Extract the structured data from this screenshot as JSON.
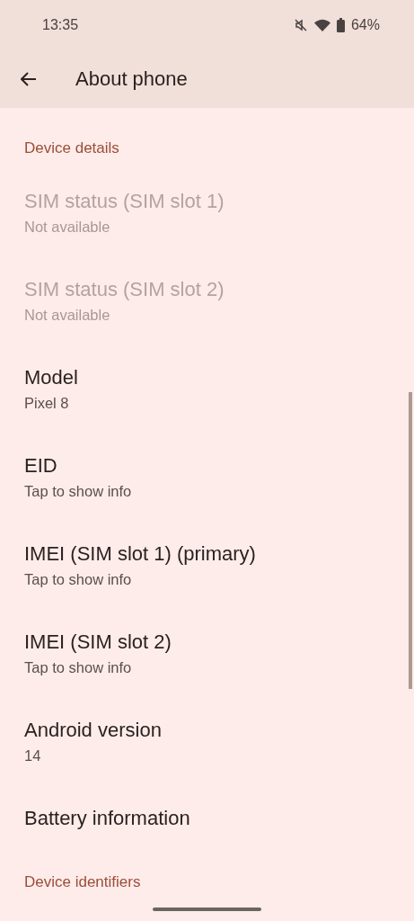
{
  "status_bar": {
    "time": "13:35",
    "battery": "64%"
  },
  "app_bar": {
    "title": "About phone"
  },
  "sections": [
    {
      "title": "Device details",
      "items": [
        {
          "title": "SIM status (SIM slot 1)",
          "summary": "Not available",
          "disabled": true
        },
        {
          "title": "SIM status (SIM slot 2)",
          "summary": "Not available",
          "disabled": true
        },
        {
          "title": "Model",
          "summary": "Pixel 8",
          "disabled": false
        },
        {
          "title": "EID",
          "summary": "Tap to show info",
          "disabled": false
        },
        {
          "title": "IMEI (SIM slot 1) (primary)",
          "summary": "Tap to show info",
          "disabled": false
        },
        {
          "title": "IMEI (SIM slot 2)",
          "summary": "Tap to show info",
          "disabled": false
        },
        {
          "title": "Android version",
          "summary": "14",
          "disabled": false
        },
        {
          "title": "Battery information",
          "disabled": false
        }
      ]
    },
    {
      "title": "Device identifiers"
    }
  ]
}
